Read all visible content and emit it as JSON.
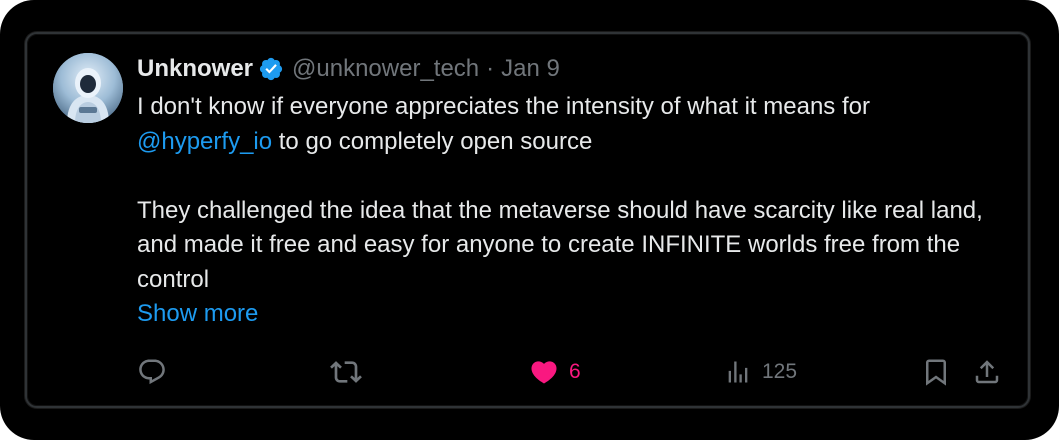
{
  "tweet": {
    "display_name": "Unknower",
    "handle": "@unknower_tech",
    "separator": "·",
    "date": "Jan 9",
    "text_line1_a": "I don't know if everyone appreciates the intensity of what it means for",
    "mention": "@hyperfy_io",
    "text_line1_b": " to go completely open source",
    "text_para2": "They challenged the idea that the metaverse should have scarcity like real land, and made it free and easy for anyone to create INFINITE worlds free from the control",
    "show_more": "Show more"
  },
  "actions": {
    "reply_icon": "reply-icon",
    "retweet_icon": "retweet-icon",
    "like_icon": "heart-filled-icon",
    "like_count": "6",
    "views_icon": "views-icon",
    "views_count": "125",
    "bookmark_icon": "bookmark-icon",
    "share_icon": "share-icon"
  },
  "colors": {
    "background": "#000000",
    "text": "#e7e9ea",
    "muted": "#71767b",
    "link": "#1d9bf0",
    "like": "#f91880",
    "verified": "#1d9bf0"
  }
}
